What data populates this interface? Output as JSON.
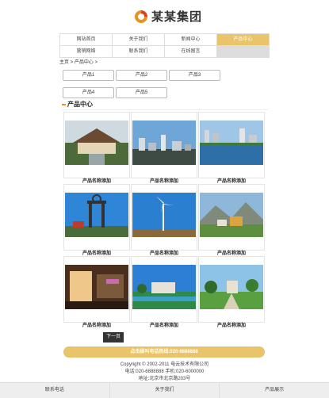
{
  "brand": {
    "name": "某某集团"
  },
  "nav": {
    "row1": [
      "网站首页",
      "关于我们",
      "新闻中心",
      "产品中心"
    ],
    "row2": [
      "营销网络",
      "联系我们",
      "在线留言",
      ""
    ]
  },
  "breadcrumb": "主页 > 产品中心 >",
  "categories": [
    "产品1",
    "产品2",
    "产品3",
    "产品4",
    "产品5"
  ],
  "section_title": "产品中心",
  "products": [
    {
      "caption": "产品名称添加",
      "scene": "resort"
    },
    {
      "caption": "产品名称添加",
      "scene": "city"
    },
    {
      "caption": "产品名称添加",
      "scene": "lake"
    },
    {
      "caption": "产品名称添加",
      "scene": "tower"
    },
    {
      "caption": "产品名称添加",
      "scene": "windmill"
    },
    {
      "caption": "产品名称添加",
      "scene": "mountain"
    },
    {
      "caption": "产品名称添加",
      "scene": "lobby"
    },
    {
      "caption": "产品名称添加",
      "scene": "garden"
    },
    {
      "caption": "产品名称添加",
      "scene": "park"
    }
  ],
  "pager": {
    "next": "下一页"
  },
  "call_bar": "点击拨叫电话热线:020-6888888",
  "footer": {
    "line1": "Copyright © 2002-2011 电云技术有限公司",
    "line2": "电话:020-6888888  手机:020-6000000",
    "line3": "地址:北京市北京路203号"
  },
  "bottom_nav": [
    "联系电话",
    "关于我们",
    "产品展示"
  ],
  "colors": {
    "accent": "#e9c46a",
    "dark": "#333333"
  }
}
